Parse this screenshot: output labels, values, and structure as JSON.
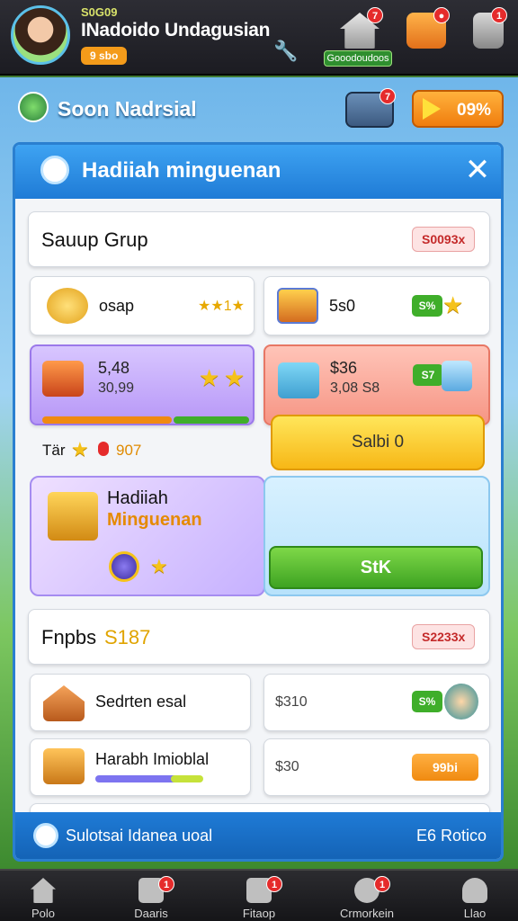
{
  "player": {
    "level": "S0G09",
    "name": "INadoido Undagusian",
    "badge": "9 sbo"
  },
  "top_icons": {
    "home_badge": "7",
    "home_label": "Gooodoudoos",
    "gift_badge": "",
    "alert_badge": "1"
  },
  "subheader": {
    "title": "Soon Nadrsial",
    "mail_badge": "7",
    "play_label": "09%"
  },
  "panel": {
    "title": "Hadiiah minguenan",
    "close": "✕",
    "section1": {
      "title": "Sauup Grup",
      "chip": "S0093x"
    },
    "row1": {
      "left_value": "osap",
      "left_stars": "★★1★",
      "right_value": "5s0",
      "right_tag": "S%"
    },
    "row2": {
      "left_line1": "5,48",
      "left_line2": "30,99",
      "right_line1": "$36",
      "right_line2": "3,08 S8",
      "right_tag": "S7"
    },
    "status": {
      "text": "Tär",
      "value": "907"
    },
    "claim_yellow": "Salbi  0",
    "weekly": {
      "title": "Hadiiah",
      "subtitle": "Minguenan"
    },
    "claim_green": "StK",
    "section2": {
      "title": "Fnpbs",
      "title_value": "S187",
      "chip": "S2233x"
    },
    "row3": {
      "left_label": "Sedrten esal",
      "right_value": "$310",
      "right_tag": "S%"
    },
    "row4": {
      "left_label": "Harabh Imioblal",
      "right_value": "$30",
      "right_tag": "99bi"
    },
    "footer": {
      "text": "Sulotsai Idanea uoal",
      "right": "E6 Rotico"
    }
  },
  "nav": [
    {
      "label": "Polo",
      "badge": ""
    },
    {
      "label": "Daaris",
      "badge": "1"
    },
    {
      "label": "Fitaop",
      "badge": "1"
    },
    {
      "label": "Crmorkein",
      "badge": "1"
    },
    {
      "label": "Llao",
      "badge": ""
    }
  ],
  "colors": {
    "accent": "#1f7bd6",
    "green": "#3fae2a",
    "orange": "#f08a10",
    "yellow": "#f7b716"
  }
}
